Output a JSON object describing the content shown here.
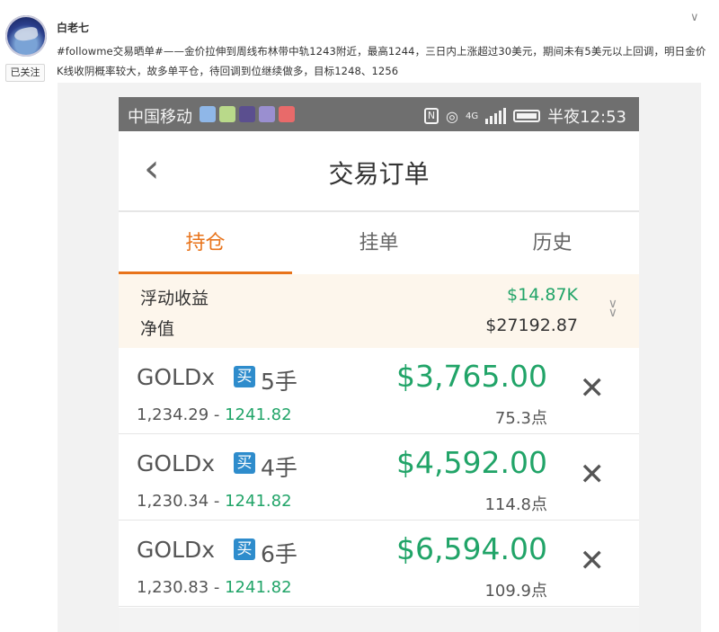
{
  "post": {
    "username": "白老七",
    "follow_label": "已关注",
    "text": "#followme交易晒单#——金价拉伸到周线布林带中轨1243附近，最高1244，三日内上涨超过30美元，期间未有5美元以上回调，明日金价K线收阴概率较大，故多单平仓，待回调到位继续做多，目标1248、1256"
  },
  "icons": {
    "more": "chevron-down-icon",
    "back": "chevron-left-icon",
    "close": "x-icon",
    "expand": "double-chevron-down-icon"
  },
  "status_bar": {
    "carrier": "中国移动",
    "network": "4G",
    "time_text": "半夜12:53"
  },
  "title_bar": {
    "title": "交易订单"
  },
  "tabs": [
    {
      "label": "持仓",
      "active": true
    },
    {
      "label": "挂单",
      "active": false
    },
    {
      "label": "历史",
      "active": false
    }
  ],
  "summary": {
    "floating_pl_label": "浮动收益",
    "floating_pl_value": "$14.87K",
    "equity_label": "净值",
    "equity_value": "$27192.87"
  },
  "orders": [
    {
      "symbol": "GOLDx",
      "side": "买",
      "lots": "5手",
      "open_price": "1,234.29",
      "separator": " - ",
      "current_price": "1241.82",
      "profit": "$3,765.00",
      "points": "75.3点"
    },
    {
      "symbol": "GOLDx",
      "side": "买",
      "lots": "4手",
      "open_price": "1,230.34",
      "separator": " - ",
      "current_price": "1241.82",
      "profit": "$4,592.00",
      "points": "114.8点"
    },
    {
      "symbol": "GOLDx",
      "side": "买",
      "lots": "6手",
      "open_price": "1,230.83",
      "separator": " - ",
      "current_price": "1241.82",
      "profit": "$6,594.00",
      "points": "109.9点"
    }
  ],
  "colors": {
    "accent": "#e8731a",
    "profit_green": "#21a468",
    "buy_badge": "#2e8ccc",
    "status_bar": "#6f6f6f",
    "summary_bg": "#fdf6ec"
  }
}
